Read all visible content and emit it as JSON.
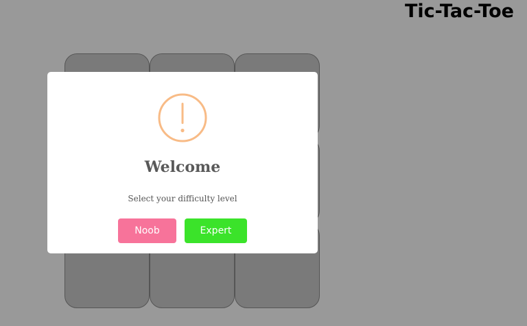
{
  "app": {
    "title": "Tic-Tac-Toe"
  },
  "board": {
    "cells": [
      "",
      "",
      "",
      "",
      "",
      "",
      "",
      "",
      ""
    ]
  },
  "dialog": {
    "icon": "warning-icon",
    "title": "Welcome",
    "text": "Select your difficulty level",
    "buttons": {
      "noob_label": "Noob",
      "expert_label": "Expert"
    }
  },
  "colors": {
    "background": "#999999",
    "cell": "#7a7a7a",
    "warning_icon": "#f8bb86",
    "noob_button": "#f7739a",
    "expert_button": "#3be32a"
  }
}
